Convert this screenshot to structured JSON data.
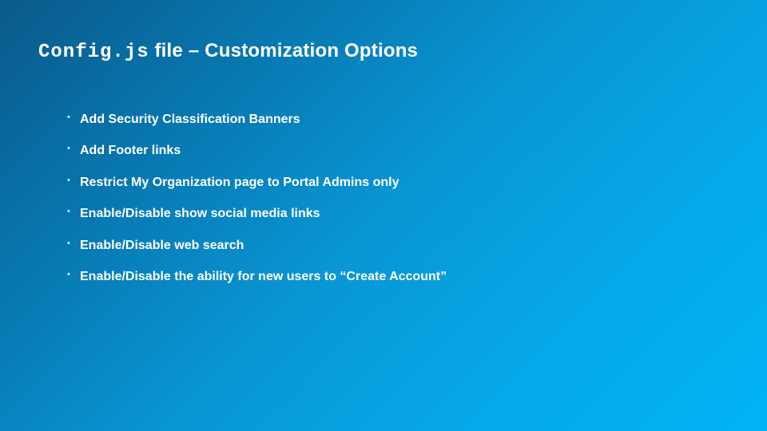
{
  "title": {
    "code": "Config.js",
    "rest": " file – Customization Options"
  },
  "bullets": [
    "Add Security Classification Banners",
    "Add Footer links",
    "Restrict My Organization page to Portal Admins only",
    "Enable/Disable show social media links",
    "Enable/Disable web search",
    "Enable/Disable the ability for new users to “Create Account”"
  ]
}
